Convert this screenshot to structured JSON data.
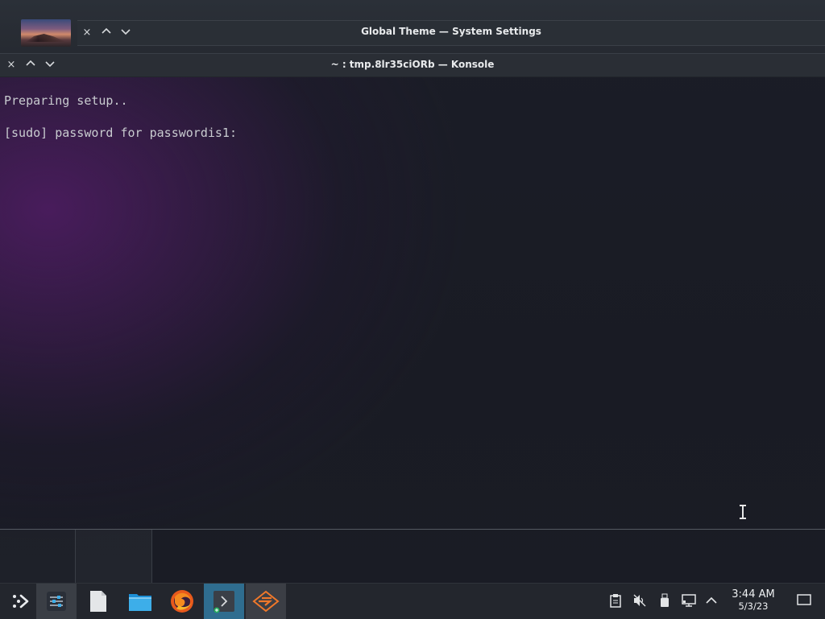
{
  "background_window": {
    "title": "Global Theme — System Settings",
    "buttons": {
      "close": "×",
      "minimize": "⌃",
      "maximize": "⌄"
    }
  },
  "konsole": {
    "title": "~ : tmp.8lr35ciORb — Konsole",
    "buttons": {
      "close": "×",
      "minimize": "⌃",
      "maximize": "⌄"
    },
    "lines": [
      "Preparing setup..",
      "[sudo] password for passwordis1:"
    ]
  },
  "taskbar": {
    "apps": [
      {
        "name": "application-launcher",
        "active": false
      },
      {
        "name": "system-settings",
        "active": true
      },
      {
        "name": "text-editor",
        "active": false
      },
      {
        "name": "file-manager",
        "active": false
      },
      {
        "name": "firefox",
        "active": false
      },
      {
        "name": "konsole",
        "active": true
      },
      {
        "name": "app-orange",
        "active": true
      }
    ],
    "tray": [
      "clipboard-icon",
      "volume-muted-icon",
      "usb-icon",
      "network-icon",
      "chevron-up-icon"
    ],
    "clock": {
      "time": "3:44 AM",
      "date": "5/3/23"
    },
    "show_desktop": "show-desktop-icon"
  },
  "colors": {
    "accent": "#2f6d8f",
    "terminal_text": "#c9ccd0"
  }
}
